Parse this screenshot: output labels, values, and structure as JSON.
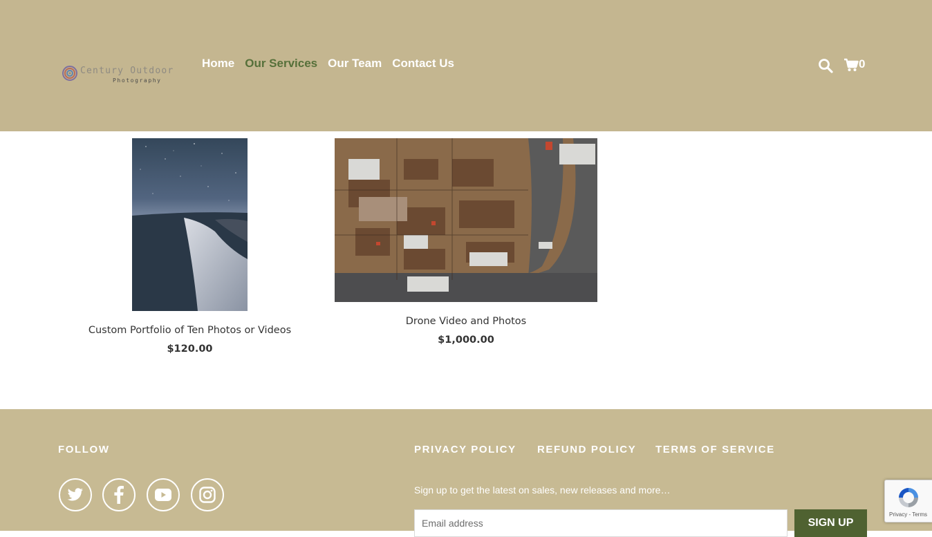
{
  "page": {
    "loading_progress": 0.2
  },
  "header": {
    "logo": {
      "name": "Century Outdoor",
      "tagline": "Photography"
    },
    "nav": [
      {
        "label": "Home",
        "active": false
      },
      {
        "label": "Our Services",
        "active": true
      },
      {
        "label": "Our Team",
        "active": false
      },
      {
        "label": "Contact Us",
        "active": false
      }
    ],
    "search_icon": "search-icon",
    "cart_icon": "cart-icon",
    "cart_count": "0",
    "colors": {
      "background": "#c4b690",
      "active_link": "#56703a",
      "link": "#ffffff"
    }
  },
  "products": [
    {
      "title": "Custom Portfolio of Ten Photos or Videos",
      "price": "$120.00",
      "image": "night-sky-sand-dune-photo"
    },
    {
      "title": "Drone Video and Photos",
      "price": "$1,000.00",
      "image": "aerial-industrial-yard-photo"
    }
  ],
  "footer": {
    "follow_heading": "FOLLOW",
    "social": [
      "twitter-icon",
      "facebook-icon",
      "youtube-icon",
      "instagram-icon"
    ],
    "policies": [
      "PRIVACY POLICY",
      "REFUND POLICY",
      "TERMS OF SERVICE"
    ],
    "newsletter": {
      "text": "Sign up to get the latest on sales, new releases and more…",
      "email_placeholder": "Email address",
      "email_value": "",
      "button": "SIGN UP"
    },
    "colors": {
      "background": "#c7ba93",
      "button": "#4f6231"
    }
  },
  "recaptcha": {
    "privacy": "Privacy",
    "separator": "-",
    "terms": "Terms"
  }
}
